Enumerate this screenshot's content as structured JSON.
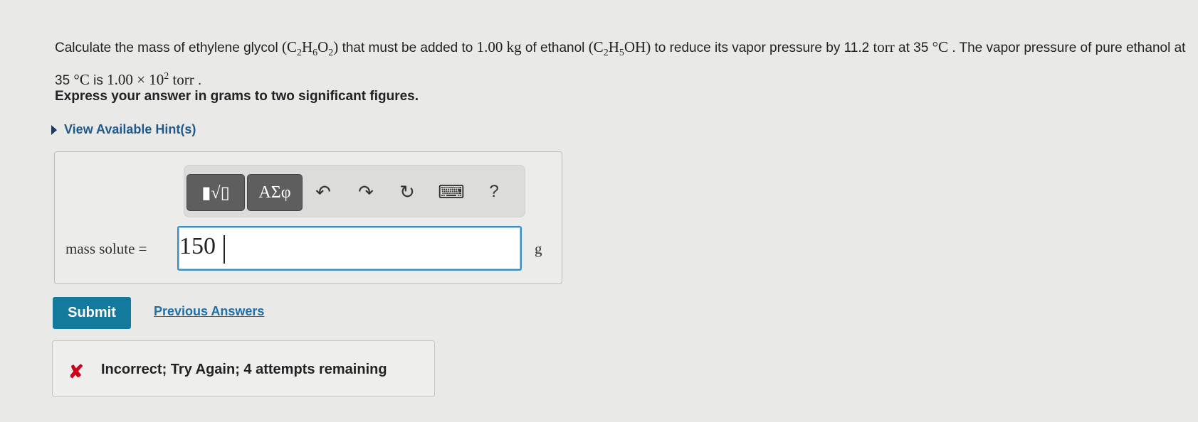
{
  "question": {
    "p1": "Calculate the mass of ethylene glycol ",
    "f1_c": "(C",
    "f1_c_sub": "2",
    "f1_h": "H",
    "f1_h_sub": "6",
    "f1_o": "O",
    "f1_o_sub": "2",
    "f1_end": ")",
    "p2": " that must be added to ",
    "mass_value": "1.00 kg",
    "p3": " of ethanol ",
    "f2_c": "(C",
    "f2_c_sub": "2",
    "f2_h": "H",
    "f2_h_sub": "5",
    "f2_end": "OH)",
    "p4": " to reduce its vapor pressure by 11.2 ",
    "torr1": "torr",
    "p5": " at 35 ",
    "deg1": "°C",
    "p6": " . The vapor pressure of pure ethanol at 35 ",
    "deg2": "°C",
    "p7": " is ",
    "pressure_base": "1.00 × 10",
    "pressure_exp": "2",
    "torr2": " torr",
    "p8": " ."
  },
  "instruction": "Express your answer in grams to two significant figures.",
  "hints_label": "View Available Hint(s)",
  "toolbar": {
    "templates_label": "▮√▯",
    "symbols_label": "ΑΣφ",
    "undo": "↶",
    "redo": "↷",
    "reset": "↻",
    "keyboard": "⌨",
    "help": "?"
  },
  "answer": {
    "label": "mass solute =",
    "value": "150",
    "unit": "g"
  },
  "submit_label": "Submit",
  "previous_answers_label": "Previous Answers",
  "feedback": {
    "icon": "✘",
    "text": "Incorrect; Try Again; 4 attempts remaining",
    "color": "#d0021b"
  },
  "colors": {
    "accent": "#137a9e",
    "link": "#1f6fa8"
  }
}
